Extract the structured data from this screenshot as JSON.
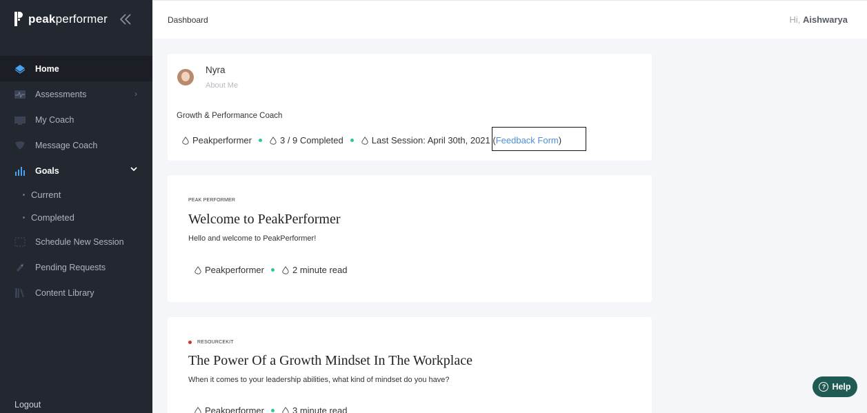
{
  "brand": {
    "bold": "peak",
    "light": "performer"
  },
  "sidebar": {
    "items": [
      {
        "label": "Home",
        "icon": "diamond-icon"
      },
      {
        "label": "Assessments",
        "icon": "pulse-icon"
      },
      {
        "label": "My Coach",
        "icon": "monitor-icon"
      },
      {
        "label": "Message Coach",
        "icon": "chat-icon"
      },
      {
        "label": "Goals",
        "icon": "bar-chart-icon"
      },
      {
        "label": "Schedule New Session",
        "icon": "calendar-icon"
      },
      {
        "label": "Pending Requests",
        "icon": "rocket-icon"
      },
      {
        "label": "Content Library",
        "icon": "books-icon"
      }
    ],
    "goals_sub": [
      "Current",
      "Completed"
    ],
    "logout": "Logout"
  },
  "header": {
    "breadcrumb": "Dashboard",
    "greeting_prefix": "Hi,",
    "user": "Aishwarya"
  },
  "coach_card": {
    "name": "Nyra",
    "about": "About Me",
    "title": "Growth & Performance Coach",
    "org": "Peakperformer",
    "progress": "3 / 9 Completed",
    "last_session_prefix": "Last Session: April 30th, 2021 (",
    "feedback_link": "Feedback Form",
    "last_session_suffix": ")"
  },
  "articles": [
    {
      "tag": "PEAK PERFORMER",
      "title": "Welcome to PeakPerformer",
      "desc": "Hello and welcome to PeakPerformer!",
      "author": "Peakperformer",
      "read": "2 minute read"
    },
    {
      "tag": "RESOURCEKIT",
      "title": "The Power Of a Growth Mindset In The Workplace",
      "desc": "When it comes to your leadership abilities, what kind of mindset do you have?",
      "author": "Peakperformer",
      "read": "3 minute read"
    }
  ],
  "help": {
    "label": "Help"
  },
  "colors": {
    "sidebar": "#232730",
    "accent_dot": "#2ec4a0",
    "link": "#4a90d9",
    "help_bg": "#1f5b52",
    "tag_red": "#d0342c"
  }
}
